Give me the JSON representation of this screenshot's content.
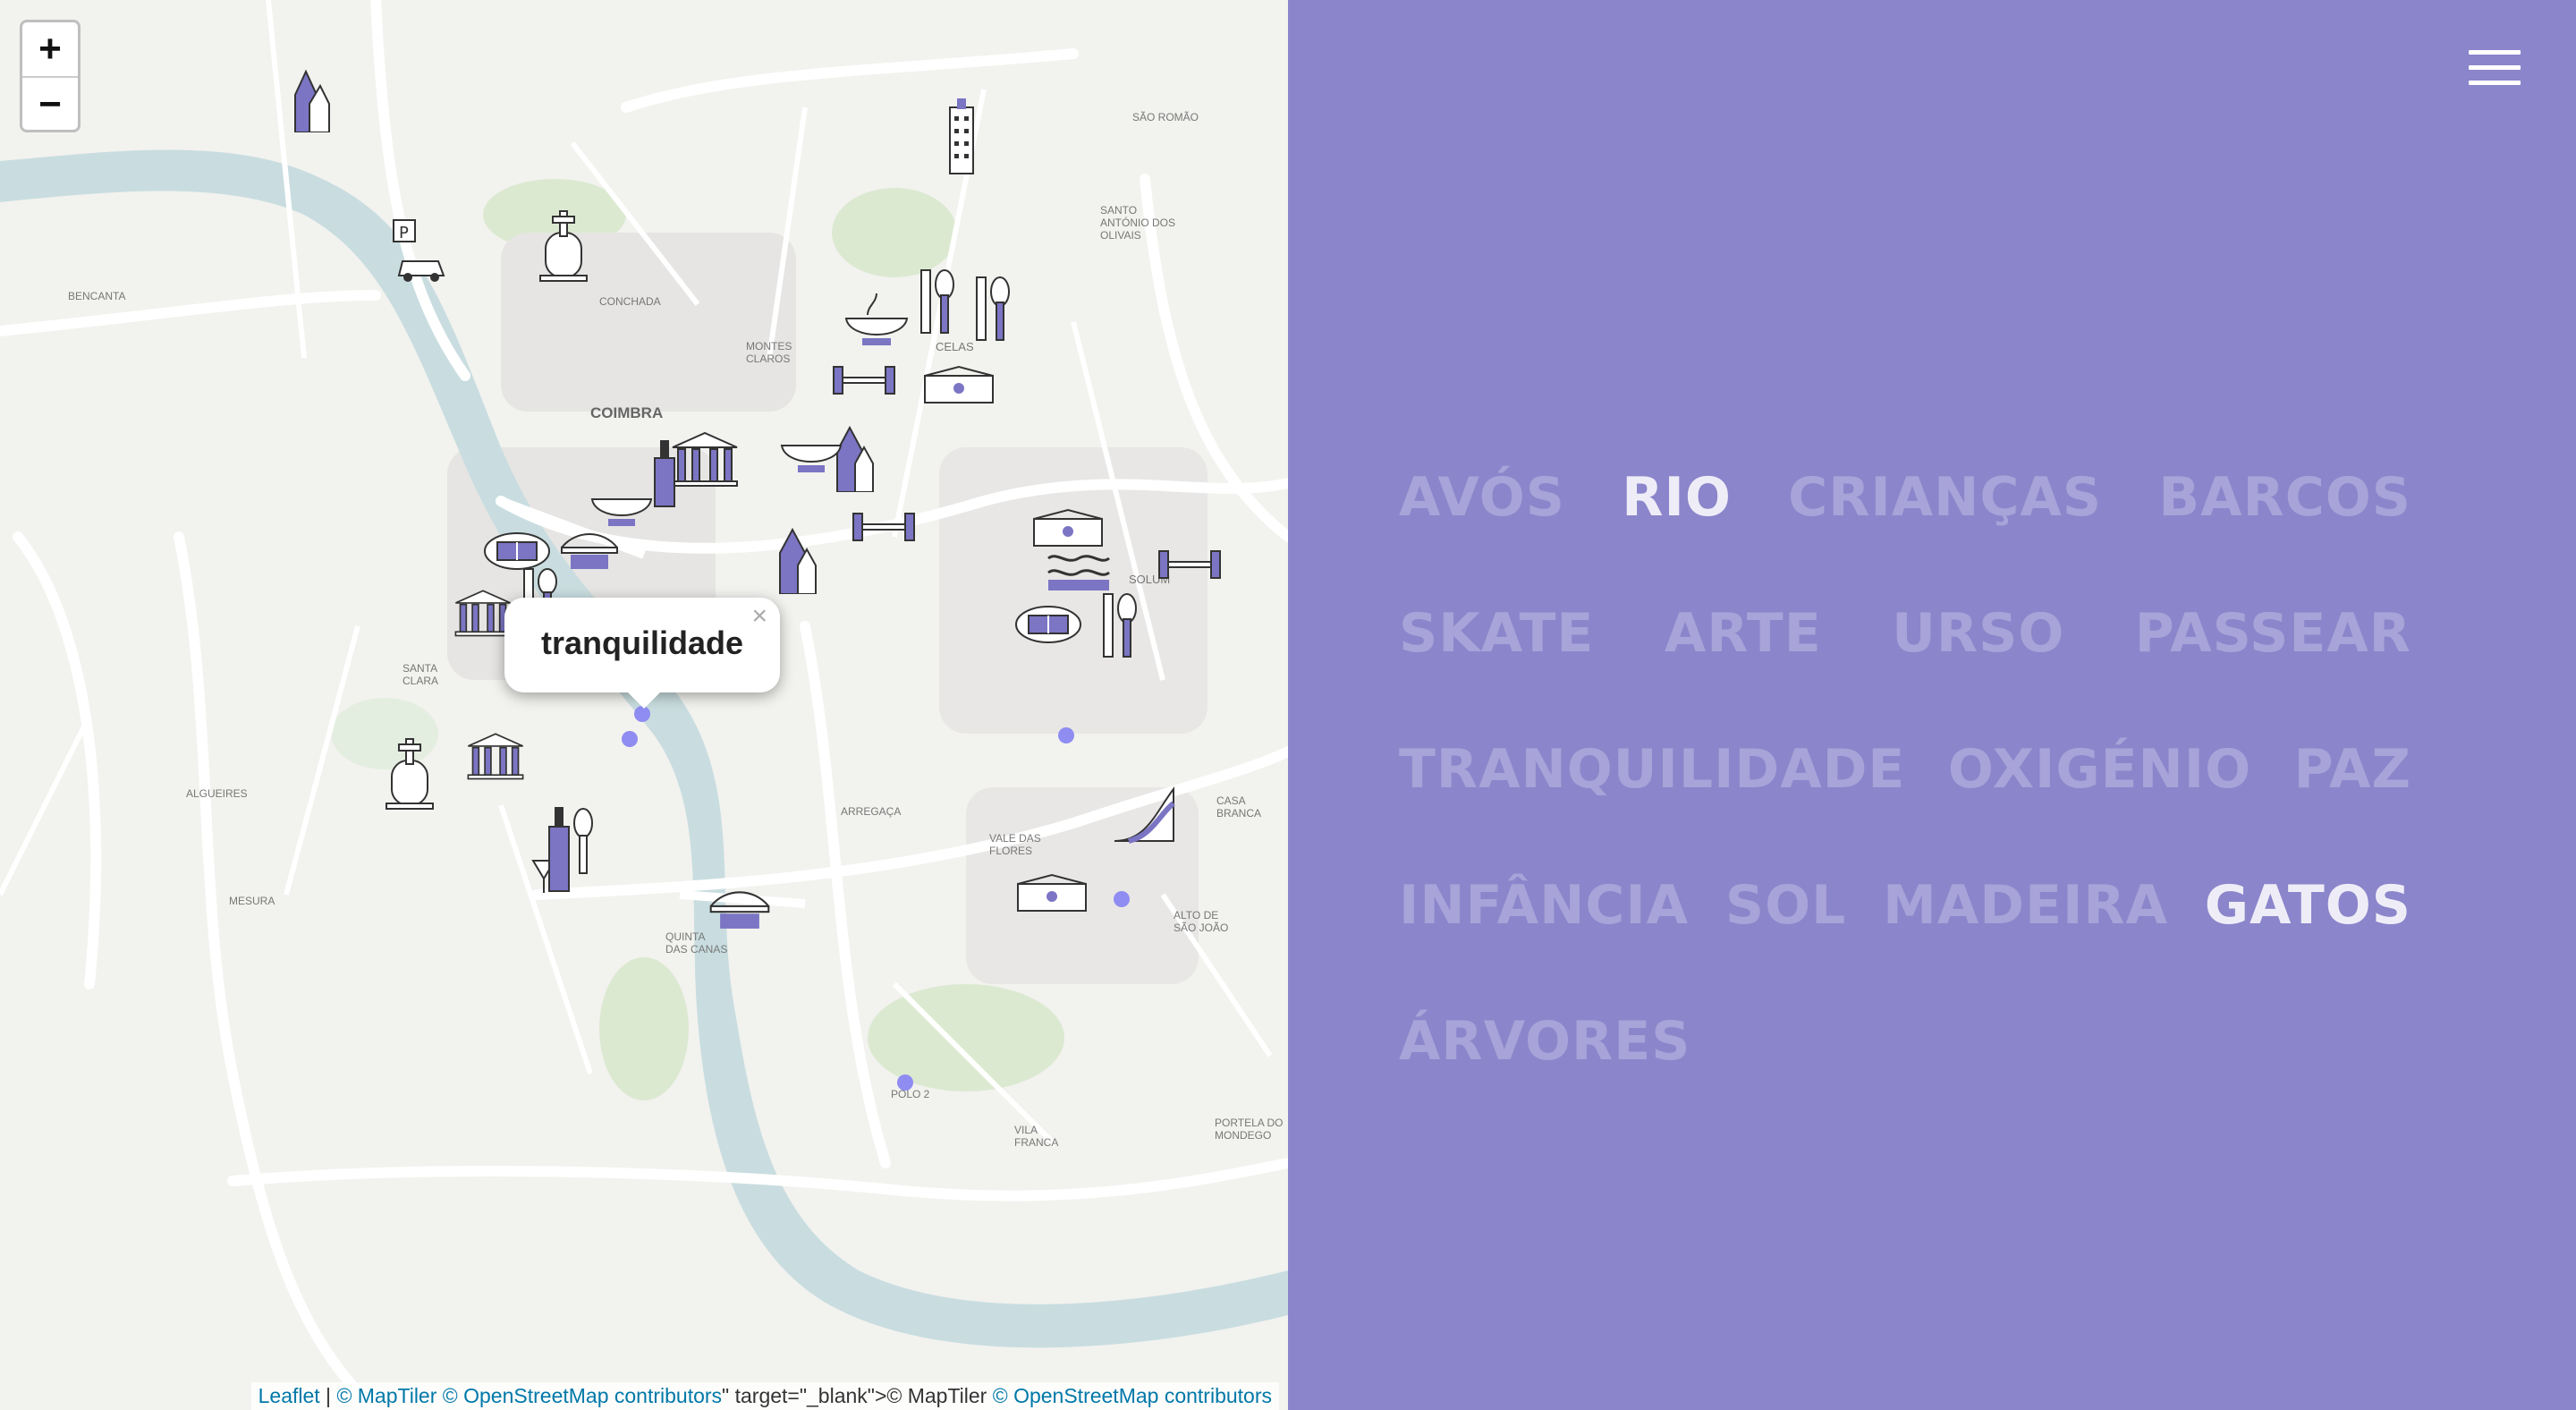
{
  "map": {
    "zoom_in_label": "+",
    "zoom_out_label": "−",
    "popup": {
      "text": "tranquilidade",
      "close": "×"
    },
    "attribution": {
      "leaflet": "Leaflet",
      "sep": " | ",
      "maptiler1": "© MapTiler",
      "osm1": "© OpenStreetMap contributors",
      "junk": "\" target=\"_blank\">",
      "maptiler2": "© MapTiler",
      "osm2": "© OpenStreetMap contributors"
    },
    "place_labels": [
      {
        "name": "COIMBRA"
      },
      {
        "name": "CELAS"
      },
      {
        "name": "SOLUM"
      },
      {
        "name": "MONTES CLAROS"
      },
      {
        "name": "SANTA CLARA"
      },
      {
        "name": "QUINTA DAS CANAS"
      },
      {
        "name": "ALTO DE SÃO JOÃO"
      },
      {
        "name": "PORTELA DO MONDEGO"
      },
      {
        "name": "ALGUEIRES"
      },
      {
        "name": "SANTO ANTÓNIO DOS OLIVAIS"
      },
      {
        "name": "SÃO ROMÃO"
      },
      {
        "name": "CONCHADA"
      },
      {
        "name": "ARREGAÇA"
      },
      {
        "name": "VALE DAS FLORES"
      },
      {
        "name": "CASA BRANCA"
      },
      {
        "name": "VILA FRANCA"
      },
      {
        "name": "POLO 2"
      },
      {
        "name": "MESURA"
      },
      {
        "name": "BENCANTA"
      }
    ],
    "icons": [
      {
        "name": "tree-icon"
      },
      {
        "name": "building-icon"
      },
      {
        "name": "parking-icon"
      },
      {
        "name": "grave-icon"
      },
      {
        "name": "boat-icon"
      },
      {
        "name": "cutlery-icon"
      },
      {
        "name": "dumbbell-icon"
      },
      {
        "name": "school-icon"
      },
      {
        "name": "bowl-icon"
      },
      {
        "name": "museum-icon"
      },
      {
        "name": "stadium-icon"
      },
      {
        "name": "bridge-icon"
      },
      {
        "name": "skate-ramp-icon"
      },
      {
        "name": "pool-icon"
      },
      {
        "name": "bottle-icon"
      }
    ]
  },
  "panel": {
    "menu_icon": "hamburger-icon",
    "words": [
      [
        {
          "label": "AVÓS",
          "active": false
        },
        {
          "label": "RIO",
          "active": true
        },
        {
          "label": "CRIANÇAS",
          "active": false
        },
        {
          "label": "BARCOS",
          "active": false
        }
      ],
      [
        {
          "label": "SKATE",
          "active": false
        },
        {
          "label": "ARTE",
          "active": false
        },
        {
          "label": "URSO",
          "active": false
        },
        {
          "label": "PASSEAR",
          "active": false
        }
      ],
      [
        {
          "label": "TRANQUILIDADE",
          "active": false
        },
        {
          "label": "OXIGÉNIO",
          "active": false
        },
        {
          "label": "PAZ",
          "active": false
        }
      ],
      [
        {
          "label": "INFÂNCIA",
          "active": false
        },
        {
          "label": "SOL",
          "active": false
        },
        {
          "label": "MADEIRA",
          "active": false
        },
        {
          "label": "GATOS",
          "active": true
        }
      ],
      [
        {
          "label": "ÁRVORES",
          "active": false
        }
      ]
    ]
  },
  "colors": {
    "accent": "#8b85cb",
    "icon_fill": "#7b75c4",
    "river": "#c9dde0"
  }
}
